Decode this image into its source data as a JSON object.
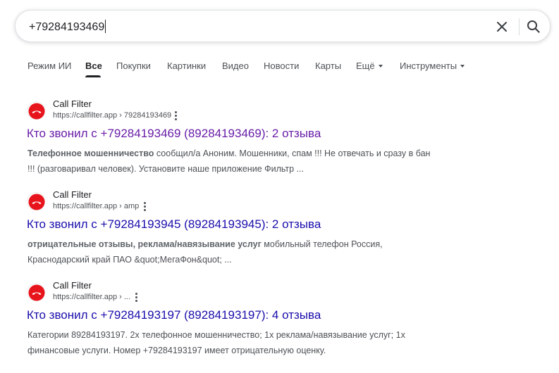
{
  "search": {
    "query": "+79284193469",
    "clear_icon": "close-icon",
    "search_icon": "search-icon"
  },
  "tabs": [
    {
      "label": "Режим ИИ"
    },
    {
      "label": "Все",
      "active": true
    },
    {
      "label": "Покупки"
    },
    {
      "label": "Картинки"
    },
    {
      "label": "Видео"
    },
    {
      "label": "Новости"
    },
    {
      "label": "Карты"
    },
    {
      "label": "Ещё",
      "dropdown": true
    },
    {
      "label": "Инструменты",
      "dropdown": true
    }
  ],
  "results": [
    {
      "site_name": "Call Filter",
      "url": "https://callfilter.app › 79284193469",
      "title": "Кто звонил с +79284193469 (89284193469): 2 отзыва",
      "visited": true,
      "snippet_bold": "Телефонное мошенничество",
      "snippet_rest": " сообщил/а Аноним. Мошенники, спам !!! Не отвечать и сразу в бан !!! (разговаривал человек). Установите наше приложение Фильтр ..."
    },
    {
      "site_name": "Call Filter",
      "url": "https://callfilter.app › amp",
      "title": "Кто звонил с +79284193945 (89284193945): 2 отзыва",
      "visited": false,
      "snippet_bold": "отрицательные отзывы, реклама/навязывание услуг",
      "snippet_rest": " мобильный телефон Россия, Краснодарский край ПАО &quot;МегаФон&quot; ..."
    },
    {
      "site_name": "Call Filter",
      "url": "https://callfilter.app › ...",
      "title": "Кто звонил с +79284193197 (89284193197): 4 отзыва",
      "visited": false,
      "snippet_bold": "",
      "snippet_rest": "Категории 89284193197. 2x телефонное мошенничество; 1x реклама/навязывание услуг; 1x финансовые услуги. Номер +79284193197 имеет отрицательную оценку."
    }
  ],
  "icons": {
    "favicon": "phone-hangup-icon",
    "more": "more-vert-icon"
  },
  "colors": {
    "visited_link": "#681da8",
    "link": "#1a0dab",
    "favicon_red": "#e8141c"
  }
}
